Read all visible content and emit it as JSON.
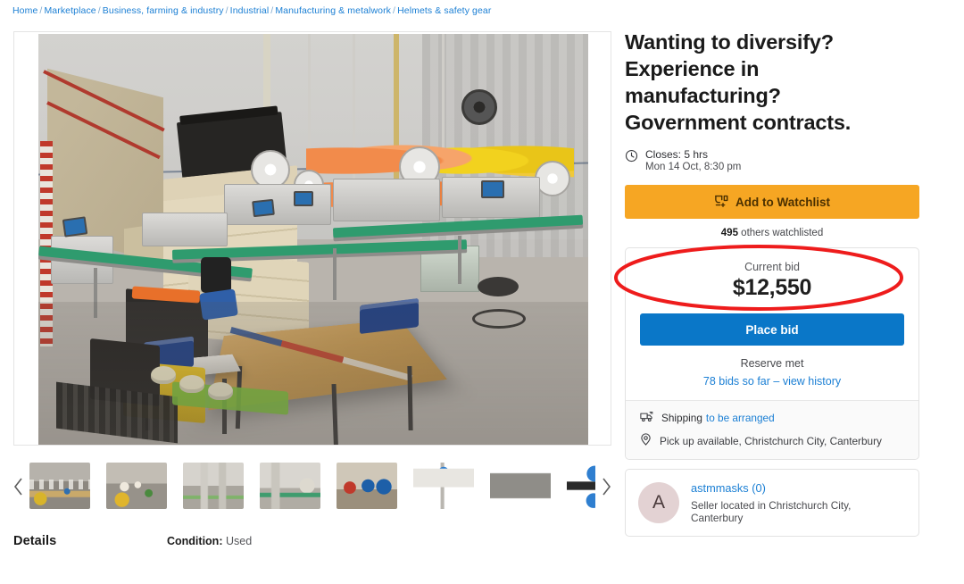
{
  "breadcrumb": {
    "items": [
      {
        "label": "Home"
      },
      {
        "label": "Marketplace"
      },
      {
        "label": "Business, farming & industry"
      },
      {
        "label": "Industrial"
      },
      {
        "label": "Manufacturing & metalwork"
      },
      {
        "label": "Helmets & safety gear"
      }
    ],
    "separator": "/"
  },
  "gallery": {
    "prev_arrow": "chevron-left-icon",
    "next_arrow": "chevron-right-icon",
    "thumbnail_count": 8,
    "hero_alt": "Factory floor with face mask production lines, conveyors and stacked boxes"
  },
  "details": {
    "heading": "Details",
    "condition_label": "Condition:",
    "condition_value": "Used"
  },
  "listing": {
    "title": "Wanting to diversify? Experience in manufacturing? Government contracts.",
    "closes_label": "Closes: 5 hrs",
    "closes_date": "Mon 14 Oct, 8:30 pm",
    "clock_icon": "clock-icon"
  },
  "watchlist": {
    "button_label": "Add to Watchlist",
    "icon": "watchlist-add-icon",
    "count": "495",
    "count_suffix": "others watchlisted"
  },
  "bidding": {
    "current_bid_label": "Current bid",
    "current_bid_amount": "$12,550",
    "place_bid_label": "Place bid",
    "reserve_status": "Reserve met",
    "bid_history_link": "78 bids so far – view history",
    "highlight": {
      "shape": "ellipse",
      "color": "#ee1c1c"
    }
  },
  "delivery": {
    "shipping_label": "Shipping",
    "shipping_link": "to be arranged",
    "shipping_icon": "truck-icon",
    "pickup_text": "Pick up available, Christchurch City, Canterbury",
    "pickup_icon": "map-pin-icon"
  },
  "seller": {
    "avatar_initial": "A",
    "name": "astmmasks (0)",
    "location": "Seller located in Christchurch City, Canterbury"
  },
  "colors": {
    "link": "#1b7fd4",
    "watchlist_orange": "#f6a623",
    "place_bid_blue": "#0a77c8",
    "annotation_red": "#ee1c1c",
    "avatar_bg": "#e3d2d3"
  }
}
